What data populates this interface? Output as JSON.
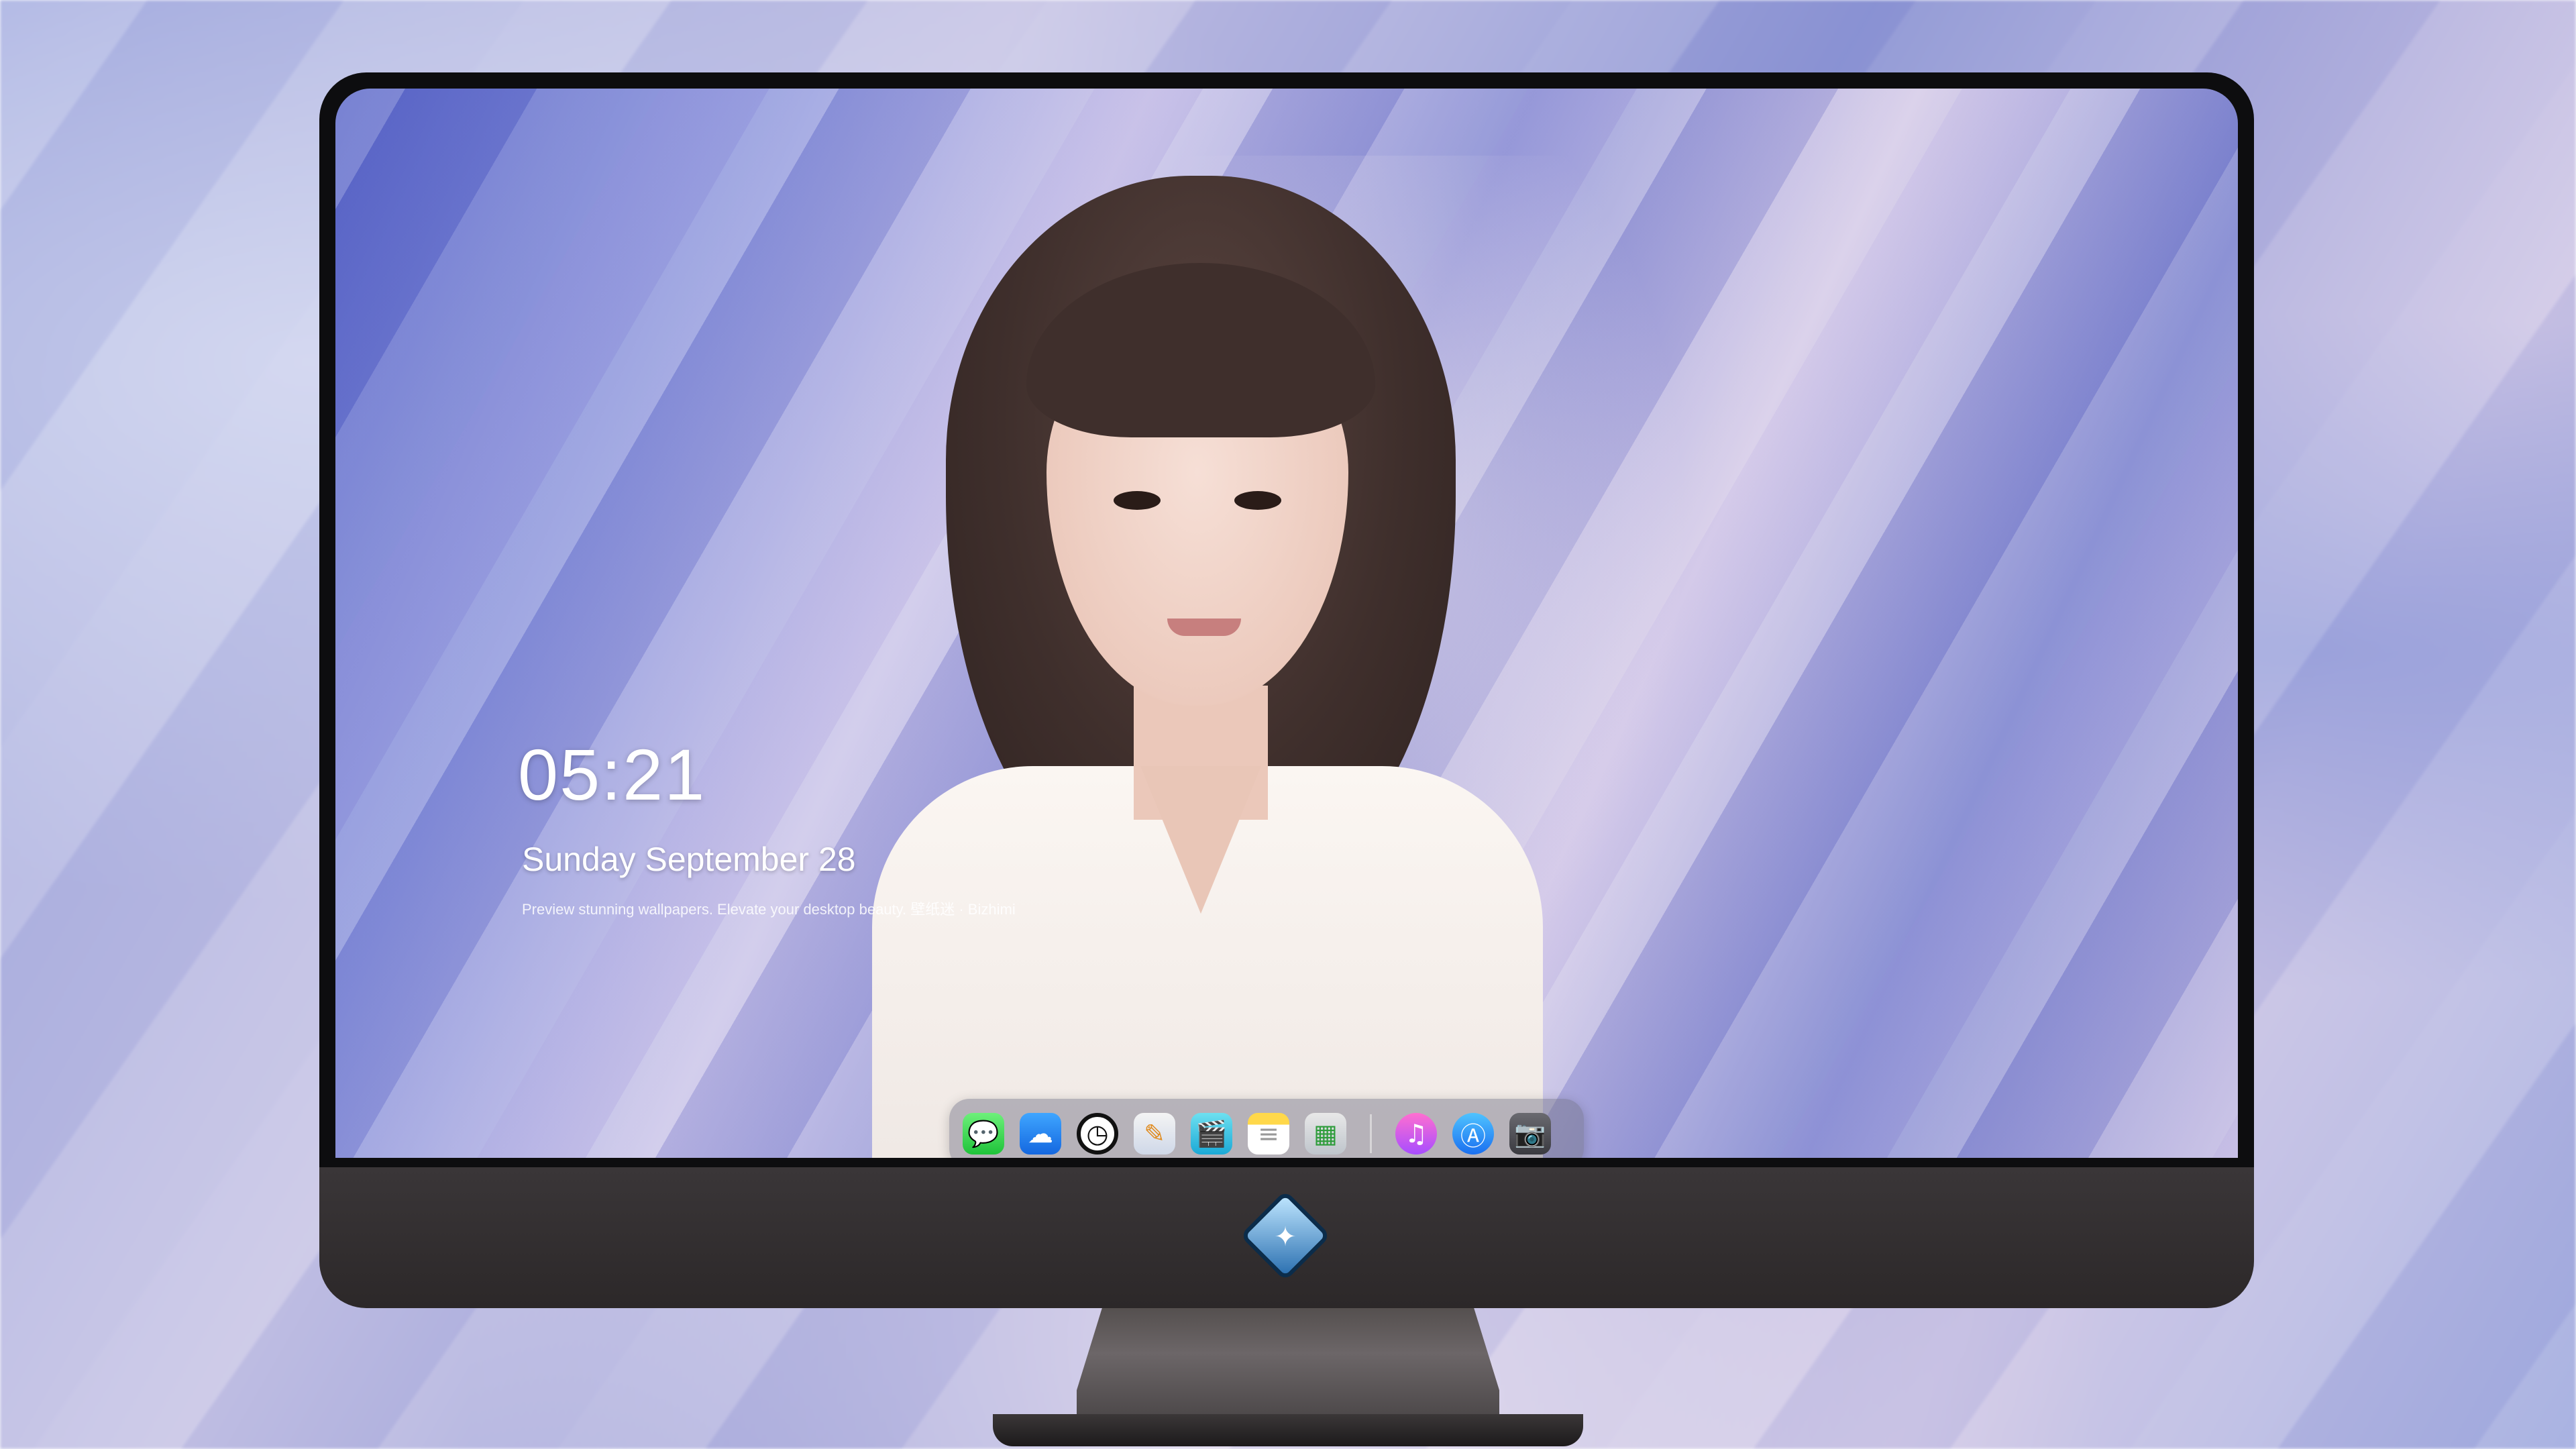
{
  "lockscreen": {
    "time": "05:21",
    "date": "Sunday September 28",
    "tagline": "Preview stunning wallpapers. Elevate your desktop beauty. 壁纸迷 · Bizhimi"
  },
  "dock": {
    "apps": [
      {
        "name": "messages-icon",
        "glyph": "💬"
      },
      {
        "name": "weather-icon",
        "glyph": "☁"
      },
      {
        "name": "clock-icon",
        "glyph": "◷"
      },
      {
        "name": "preview-icon",
        "glyph": "✎"
      },
      {
        "name": "clips-icon",
        "glyph": "🎬"
      },
      {
        "name": "notes-icon",
        "glyph": "≡"
      },
      {
        "name": "numbers-icon",
        "glyph": "▦"
      },
      {
        "name": "music-icon",
        "glyph": "♫"
      },
      {
        "name": "app-store-icon",
        "glyph": "Ⓐ"
      },
      {
        "name": "camera-icon",
        "glyph": "📷"
      }
    ]
  },
  "brand": {
    "logo_glyph": "✦"
  },
  "colors": {
    "dock_bg": "rgba(110,110,130,0.45)",
    "bezel": "#0d0d0f",
    "chin": "#2c2829"
  }
}
